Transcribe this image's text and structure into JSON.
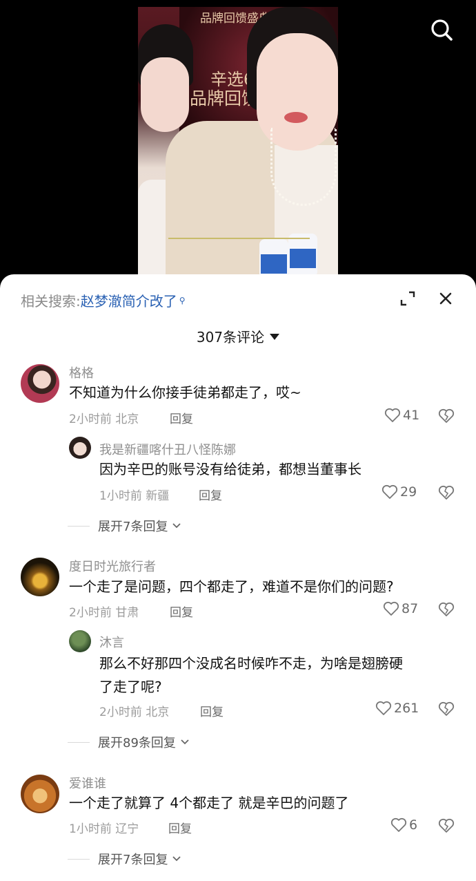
{
  "video": {
    "banner_line1": "品牌回馈盛典",
    "banner_line2": "辛选618",
    "banner_line3": "品牌回馈盛典"
  },
  "header": {
    "related_prefix": "相关搜索:",
    "related_query": "赵梦澈简介改了",
    "comment_count_label": "307条评论"
  },
  "comments": [
    {
      "user": "格格",
      "text": "不知道为什么你接手徒弟都走了，哎~",
      "time_location": "2小时前 北京",
      "reply_label": "回复",
      "likes": "41",
      "replies": [
        {
          "user": "我是新疆喀什丑八怪陈娜",
          "text": "因为辛巴的账号没有给徒弟，都想当董事长",
          "time_location": "1小时前 新疆",
          "reply_label": "回复",
          "likes": "29"
        }
      ],
      "expand_label": "展开7条回复"
    },
    {
      "user": "度日时光旅行者",
      "text": "一个走了是问题，四个都走了，难道不是你们的问题?",
      "time_location": "2小时前 甘肃",
      "reply_label": "回复",
      "likes": "87",
      "replies": [
        {
          "user": "沐言",
          "text_line1": "那么不好那四个没成名时候咋不走，为啥是翅膀硬",
          "text_line2": "了走了呢?",
          "time_location": "2小时前 北京",
          "reply_label": "回复",
          "likes": "261"
        }
      ],
      "expand_label": "展开89条回复"
    },
    {
      "user": "爱谁谁",
      "text": "一个走了就算了 4个都走了 就是辛巴的问题了",
      "time_location": "1小时前 辽宁",
      "reply_label": "回复",
      "likes": "6",
      "expand_label": "展开7条回复"
    }
  ],
  "colors": {
    "link": "#2a61b3",
    "meta": "#9b9b9b",
    "text": "#111111"
  }
}
